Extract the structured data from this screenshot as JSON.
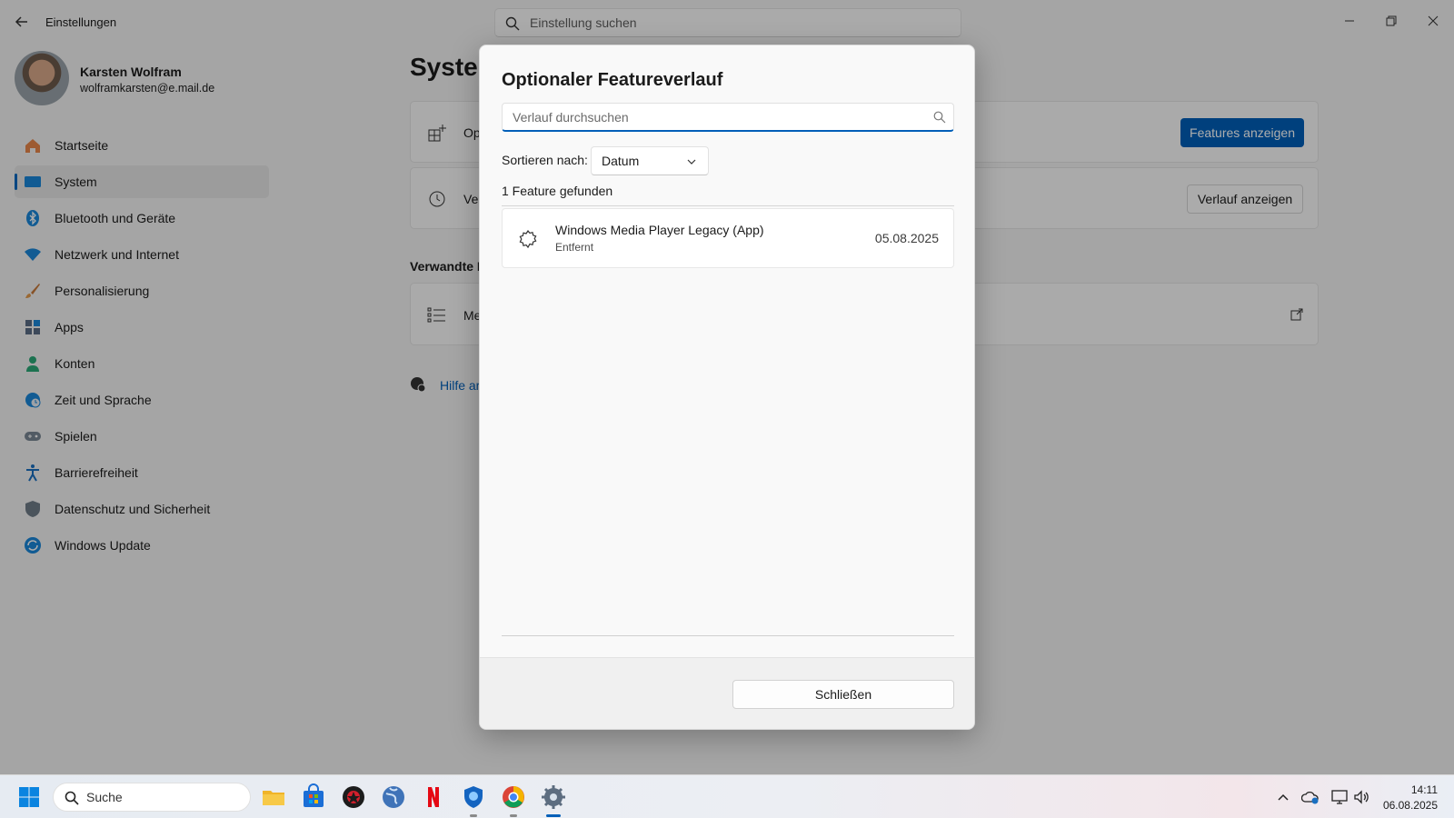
{
  "window": {
    "app_title": "Einstellungen",
    "search_placeholder": "Einstellung suchen"
  },
  "profile": {
    "name": "Karsten Wolfram",
    "email": "wolframkarsten@e.mail.de"
  },
  "sidebar": {
    "items": [
      {
        "label": "Startseite",
        "icon": "home-icon"
      },
      {
        "label": "System",
        "icon": "system-icon",
        "active": true
      },
      {
        "label": "Bluetooth und Geräte",
        "icon": "bluetooth-icon"
      },
      {
        "label": "Netzwerk und Internet",
        "icon": "wifi-icon"
      },
      {
        "label": "Personalisierung",
        "icon": "brush-icon"
      },
      {
        "label": "Apps",
        "icon": "apps-icon"
      },
      {
        "label": "Konten",
        "icon": "person-icon"
      },
      {
        "label": "Zeit und Sprache",
        "icon": "globe-clock-icon"
      },
      {
        "label": "Spielen",
        "icon": "gamepad-icon"
      },
      {
        "label": "Barrierefreiheit",
        "icon": "accessibility-icon"
      },
      {
        "label": "Datenschutz und Sicherheit",
        "icon": "shield-icon"
      },
      {
        "label": "Windows Update",
        "icon": "update-icon"
      }
    ]
  },
  "main": {
    "page_title_visible": "Syster",
    "card1_label_visible": "Op",
    "card1_button": "Features anzeigen",
    "card2_label_visible": "Ve",
    "card2_button": "Verlauf anzeigen",
    "related_heading_visible": "Verwandte E",
    "related_card_label_visible": "Me",
    "help_link_visible": "Hilfe ar"
  },
  "dialog": {
    "title": "Optionaler Featureverlauf",
    "search_placeholder": "Verlauf durchsuchen",
    "sort_label": "Sortieren nach:",
    "sort_value": "Datum",
    "result_count": "1 Feature gefunden",
    "features": [
      {
        "name": "Windows Media Player Legacy (App)",
        "status": "Entfernt",
        "date": "05.08.2025",
        "icon": "puzzle-gear-icon"
      }
    ],
    "close_button": "Schließen"
  },
  "taskbar": {
    "search_label": "Suche",
    "apps": [
      "start-icon",
      "file-explorer-icon",
      "store-icon",
      "vpn-app-icon",
      "globe-app-icon",
      "netflix-icon",
      "edge-shield-icon",
      "chrome-icon",
      "settings-icon"
    ],
    "time": "14:11",
    "date": "06.08.2025"
  },
  "colors": {
    "accent": "#005fb8",
    "overlay": "rgba(0,0,0,0.32)"
  }
}
